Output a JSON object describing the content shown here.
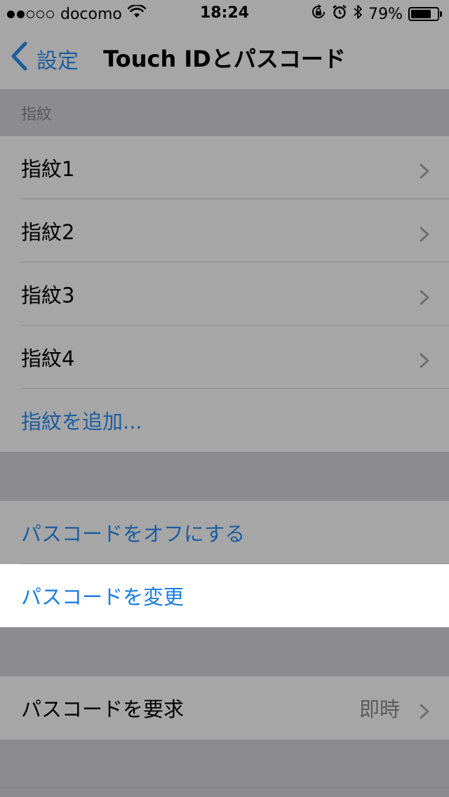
{
  "status_bar": {
    "carrier": "docomo",
    "signal_filled": 2,
    "signal_total": 5,
    "time": "18:24",
    "battery_percent": "79%",
    "battery_level": 0.79
  },
  "nav": {
    "back_label": "設定",
    "title": "Touch IDとパスコード"
  },
  "fingerprints": {
    "header": "指紋",
    "items": [
      {
        "label": "指紋1"
      },
      {
        "label": "指紋2"
      },
      {
        "label": "指紋3"
      },
      {
        "label": "指紋4"
      }
    ],
    "add_label": "指紋を追加..."
  },
  "passcode": {
    "turn_off_label": "パスコードをオフにする",
    "change_label": "パスコードを変更"
  },
  "require": {
    "label": "パスコードを要求",
    "value": "即時"
  },
  "colors": {
    "link_blue": "#1d5d9e",
    "highlight_blue": "#1a7ce0",
    "dim_background": "#a6a6a6",
    "highlight_background": "#ffffff"
  },
  "icons": [
    "wifi-icon",
    "orientation-lock-icon",
    "alarm-icon",
    "bluetooth-icon",
    "battery-icon",
    "back-chevron-icon",
    "chevron-right-icon"
  ]
}
